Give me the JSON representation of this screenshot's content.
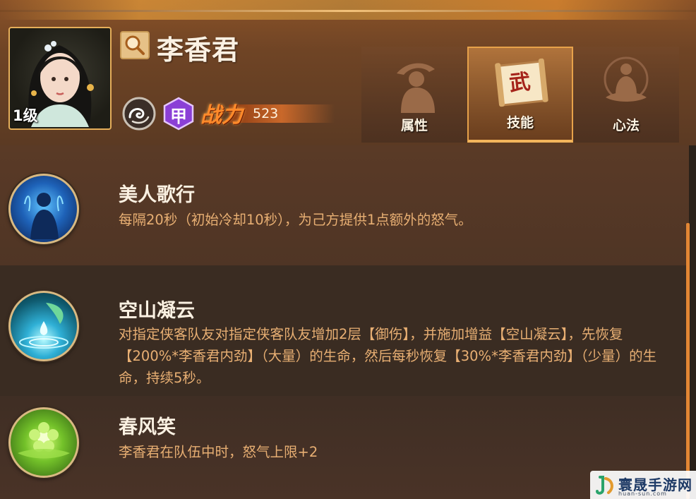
{
  "hero": {
    "name": "李香君",
    "level": "1级",
    "power_icon_text": "战力",
    "power_value": "523"
  },
  "tabs": [
    {
      "label": "属性",
      "icon": "figure-icon",
      "active": false
    },
    {
      "label": "技能",
      "icon": "scroll-icon",
      "active": true,
      "icon_text": "武"
    },
    {
      "label": "心法",
      "icon": "meditation-icon",
      "active": false
    }
  ],
  "badges": {
    "faction_icon": "cloud-swirl-icon",
    "rank_text": "甲"
  },
  "skills": [
    {
      "title": "美人歌行",
      "desc": "每隔20秒（初始冷却10秒），为己方提供1点额外的怒气。",
      "icon": "blue-figure-skill-icon"
    },
    {
      "title": "空山凝云",
      "desc": "对指定侠客队友对指定侠客队友增加2层【御伤】，并施加增益【空山凝云】，先恢复【200%*李香君内劲】（大量）的生命，然后每秒恢复【30%*李香君内劲】（少量）的生命，持续5秒。",
      "icon": "water-drop-skill-icon"
    },
    {
      "title": "春风笑",
      "desc": "李香君在队伍中时，怒气上限+2",
      "icon": "green-flower-skill-icon"
    }
  ],
  "watermark": {
    "text": "寰晟手游网",
    "url": "huan-sun.com"
  },
  "colors": {
    "accent": "#e7a24a",
    "desc_text": "#e8af73",
    "title_text": "#fbf1e2",
    "rank_badge": "#8b3fd6"
  }
}
